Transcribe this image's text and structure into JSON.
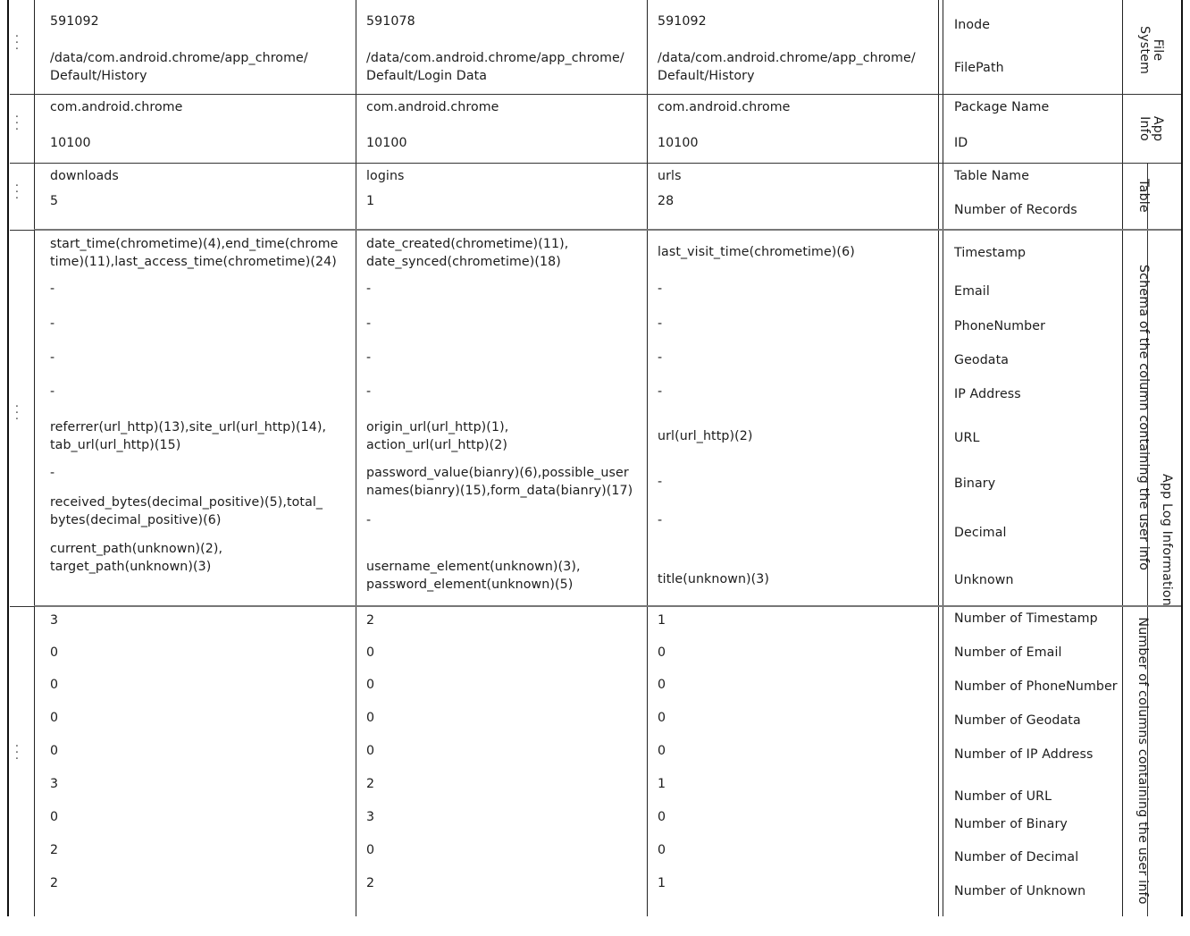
{
  "table": {
    "columns": [
      {
        "id": "col-1",
        "file_system": {
          "inode": "591092",
          "file_path": "/data/com.android.chrome/app_chrome/\nDefault/History"
        },
        "app_info": {
          "package_name": "com.android.chrome",
          "id": "10100"
        },
        "table_info": {
          "table_name": "downloads",
          "number_of_records": "5"
        },
        "schema": {
          "timestamp": "start_time(chrometime)(4),end_time(chrome\ntime)(11),last_access_time(chrometime)(24)",
          "email": "-",
          "phone_number": "-",
          "geodata": "-",
          "ip_address": "-",
          "url": "referrer(url_http)(13),site_url(url_http)(14),\ntab_url(url_http)(15)",
          "binary": "-",
          "decimal": "received_bytes(decimal_positive)(5),total_\nbytes(decimal_positive)(6)",
          "unknown": "current_path(unknown)(2),\ntarget_path(unknown)(3)"
        },
        "counts": {
          "number_of_timestamp": "3",
          "number_of_email": "0",
          "number_of_phonenumber": "0",
          "number_of_geodata": "0",
          "number_of_ip_address": "0",
          "number_of_url": "3",
          "number_of_binary": "0",
          "number_of_decimal": "2",
          "number_of_unknown": "2"
        }
      },
      {
        "id": "col-2",
        "file_system": {
          "inode": "591078",
          "file_path": "/data/com.android.chrome/app_chrome/\nDefault/Login Data"
        },
        "app_info": {
          "package_name": "com.android.chrome",
          "id": "10100"
        },
        "table_info": {
          "table_name": "logins",
          "number_of_records": "1"
        },
        "schema": {
          "timestamp": "date_created(chrometime)(11),\ndate_synced(chrometime)(18)",
          "email": "-",
          "phone_number": "-",
          "geodata": "-",
          "ip_address": "-",
          "url": "origin_url(url_http)(1),\naction_url(url_http)(2)",
          "binary": "password_value(bianry)(6),possible_user\nnames(bianry)(15),form_data(bianry)(17)",
          "decimal": "-",
          "unknown": "username_element(unknown)(3),\npassword_element(unknown)(5)"
        },
        "counts": {
          "number_of_timestamp": "2",
          "number_of_email": "0",
          "number_of_phonenumber": "0",
          "number_of_geodata": "0",
          "number_of_ip_address": "0",
          "number_of_url": "2",
          "number_of_binary": "3",
          "number_of_decimal": "0",
          "number_of_unknown": "2"
        }
      },
      {
        "id": "col-3",
        "file_system": {
          "inode": "591092",
          "file_path": "/data/com.android.chrome/app_chrome/\nDefault/History"
        },
        "app_info": {
          "package_name": "com.android.chrome",
          "id": "10100"
        },
        "table_info": {
          "table_name": "urls",
          "number_of_records": "28"
        },
        "schema": {
          "timestamp": "last_visit_time(chrometime)(6)",
          "email": "-",
          "phone_number": "-",
          "geodata": "-",
          "ip_address": "-",
          "url": "url(url_http)(2)",
          "binary": "-",
          "decimal": "-",
          "unknown": "title(unknown)(3)"
        },
        "counts": {
          "number_of_timestamp": "1",
          "number_of_email": "0",
          "number_of_phonenumber": "0",
          "number_of_geodata": "0",
          "number_of_ip_address": "0",
          "number_of_url": "1",
          "number_of_binary": "0",
          "number_of_decimal": "0",
          "number_of_unknown": "1"
        }
      }
    ],
    "row_labels": {
      "inode": "Inode",
      "file_path": "FilePath",
      "package_name": "Package Name",
      "id": "ID",
      "table_name": "Table Name",
      "number_of_records": "Number of Records",
      "timestamp": "Timestamp",
      "email": "Email",
      "phone_number": "PhoneNumber",
      "geodata": "Geodata",
      "ip_address": "IP Address",
      "url": "URL",
      "binary": "Binary",
      "decimal": "Decimal",
      "unknown": "Unknown",
      "number_of_timestamp": "Number of Timestamp",
      "number_of_email": "Number of Email",
      "number_of_phonenumber": "Number of PhoneNumber",
      "number_of_geodata": "Number of Geodata",
      "number_of_ip_address": "Number of IP Address",
      "number_of_url": "Number of URL",
      "number_of_binary": "Number of Binary",
      "number_of_decimal": "Number of Decimal",
      "number_of_unknown": "Number of Unknown"
    },
    "group_labels": {
      "file_system": "File\nSystem",
      "app_info": "App\nInfo",
      "table": "Table",
      "schema": "Schema of the column containing the user info",
      "app_log_information": "App Log Information",
      "counts": "Number of columns containing the user info"
    },
    "continuation_marker": "⋮"
  }
}
